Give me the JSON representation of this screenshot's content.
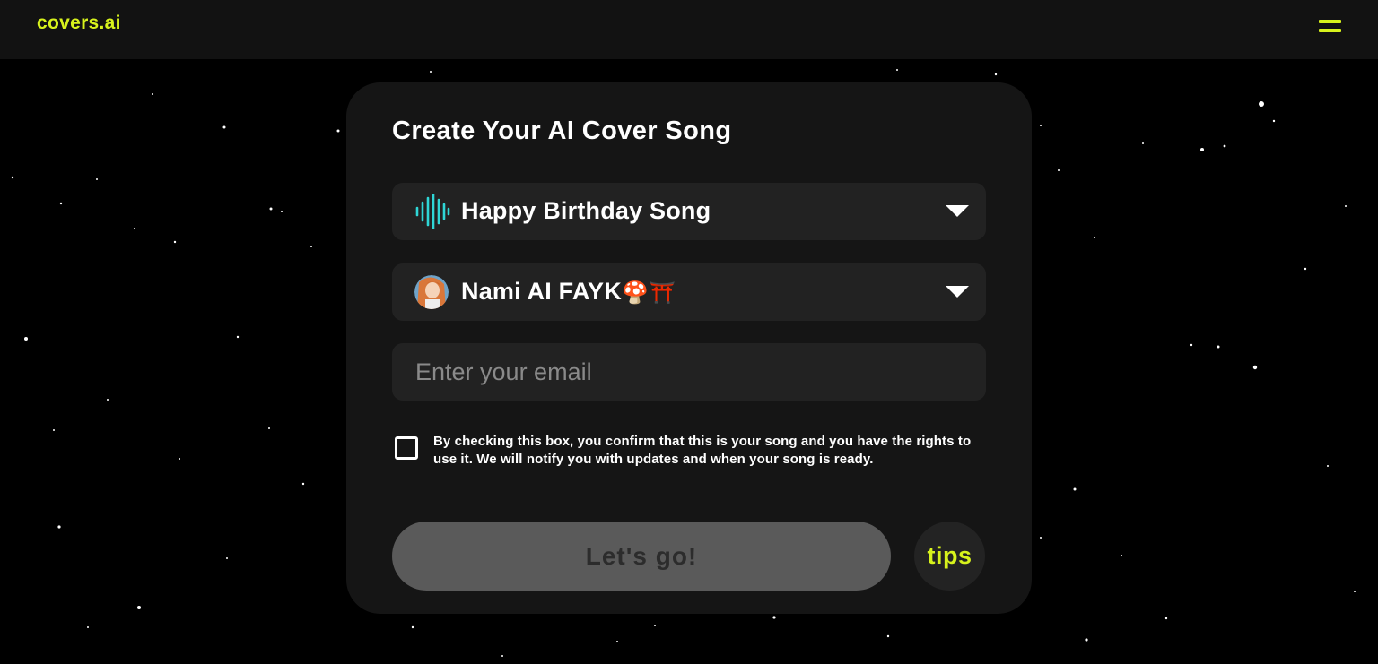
{
  "header": {
    "logo": "covers.ai",
    "menu_icon": "hamburger-icon"
  },
  "form": {
    "title": "Create Your AI Cover Song",
    "song_select": {
      "value": "Happy Birthday Song",
      "icon": "audio-wave-icon"
    },
    "voice_select": {
      "value": "Nami AI FAYK",
      "emoji_1": "🍄",
      "emoji_2": "⛩️",
      "icon": "character-avatar"
    },
    "email": {
      "placeholder": "Enter your email",
      "value": ""
    },
    "consent": {
      "checked": false,
      "text": "By checking this box, you confirm that this is your song and you have the rights to use it. We will notify you with updates and when your song is ready."
    },
    "submit_label": "Let's go!",
    "tips_label": "tips"
  },
  "colors": {
    "accent": "#d7f21c",
    "background": "#000000",
    "card": "#151515",
    "field": "#222222",
    "wave": "#2fd6d6"
  }
}
